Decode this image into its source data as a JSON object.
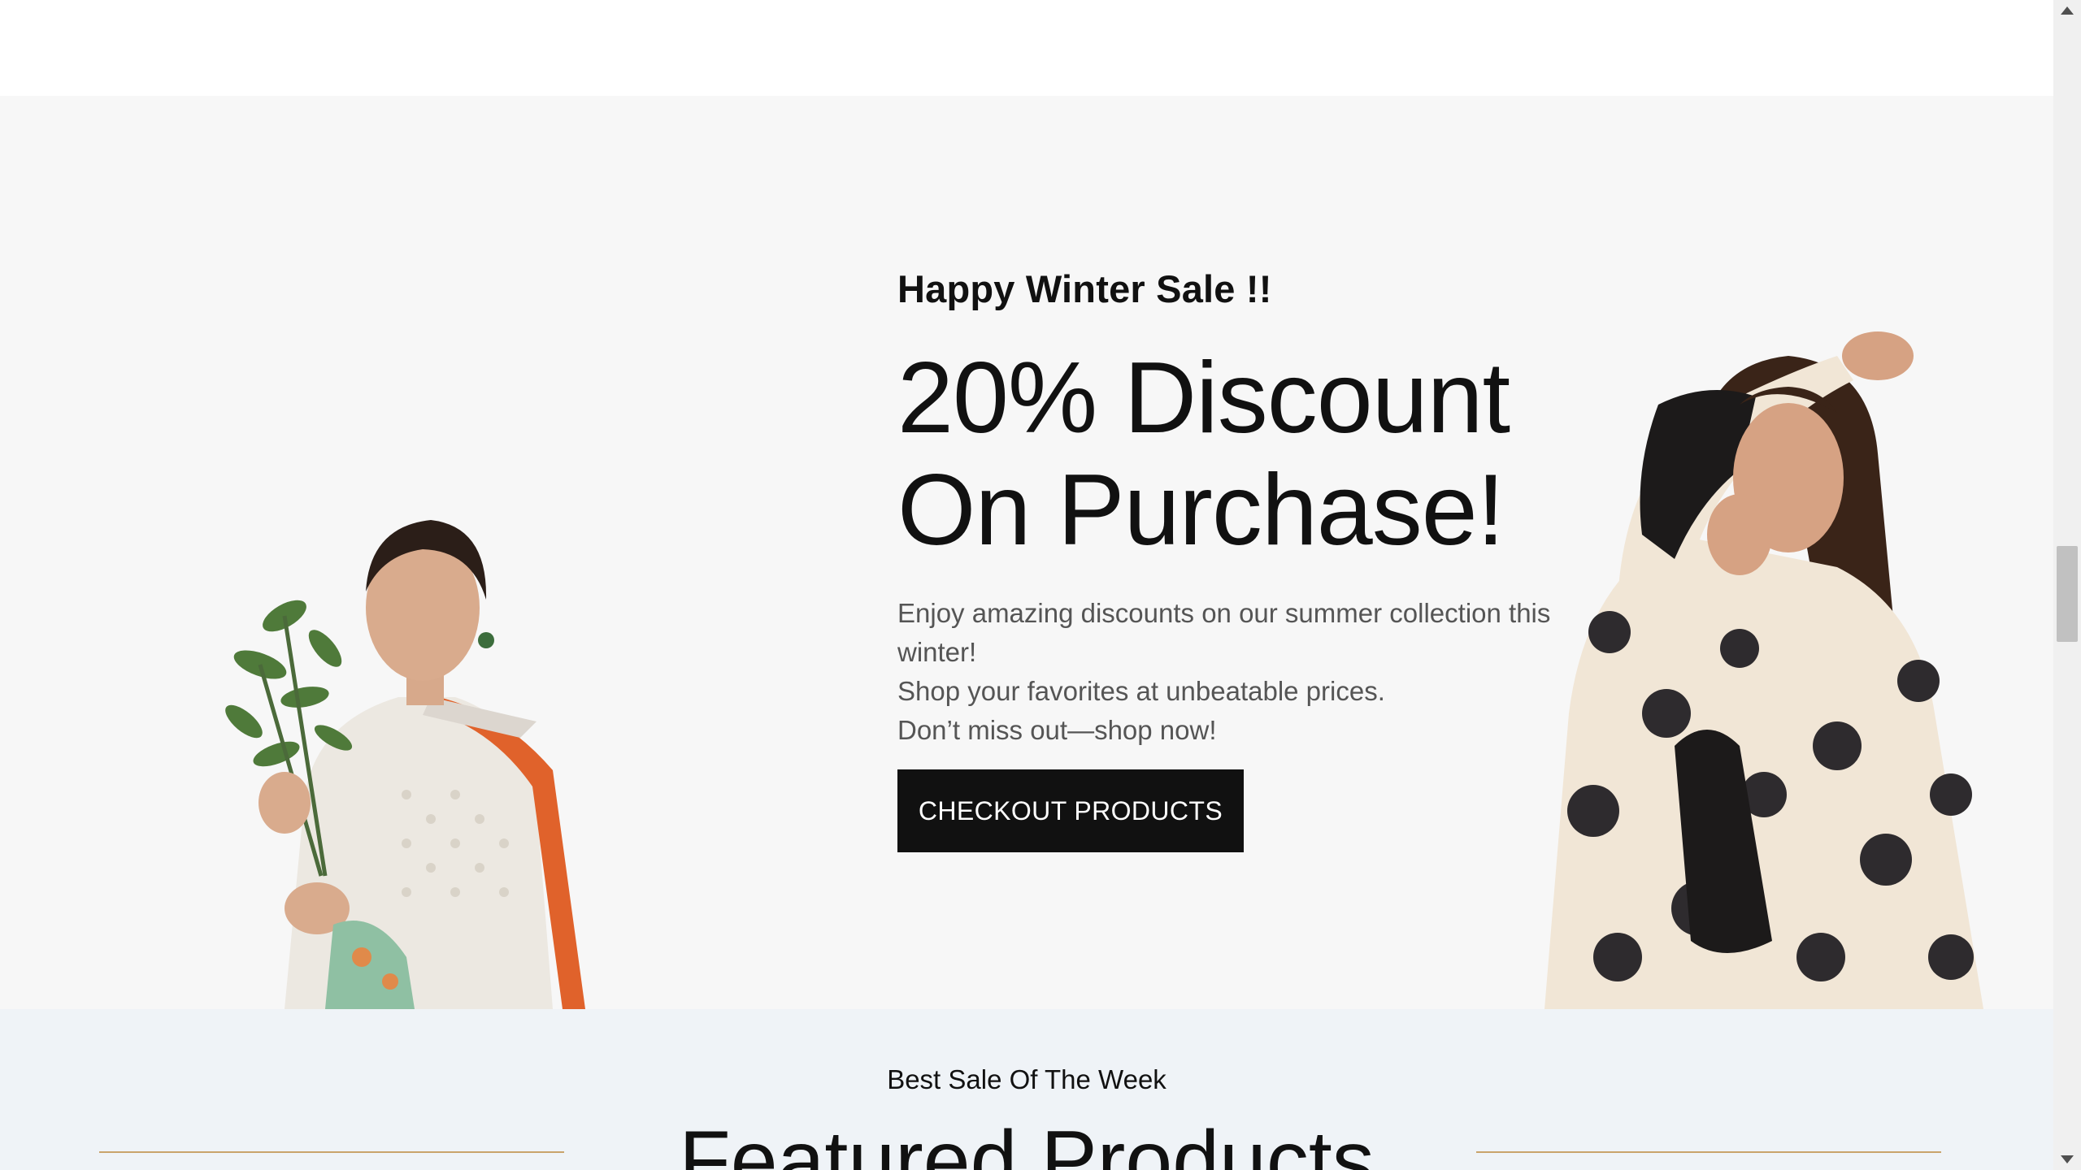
{
  "hero": {
    "eyebrow": "Happy Winter Sale !!",
    "headline_line1": "20% Discount",
    "headline_line2": "On Purchase!",
    "desc_line1": "Enjoy amazing discounts on our summer collection this winter!",
    "desc_line2": "Shop your favorites at unbeatable prices.",
    "desc_line3": "Don’t miss out—shop now!",
    "cta_label": "CHECKOUT PRODUCTS",
    "colors": {
      "background": "#f7f7f7",
      "text": "#111111",
      "button": "#111111",
      "button_text": "#ffffff"
    }
  },
  "featured": {
    "subtitle": "Best Sale Of The Week",
    "title": "Featured Products",
    "colors": {
      "background": "#eff3f7",
      "rule": "#c9a46b"
    }
  },
  "scrollbar": {
    "up_icon": "scroll-up-arrow-icon",
    "down_icon": "scroll-down-arrow-icon"
  }
}
